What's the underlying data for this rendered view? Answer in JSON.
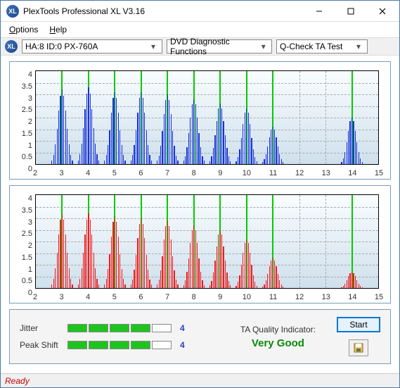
{
  "titlebar": {
    "title": "PlexTools Professional XL V3.16"
  },
  "menu": {
    "options": "Options",
    "help": "Help"
  },
  "toolbar": {
    "drive": "HA:8 ID:0   PX-760A",
    "func": "DVD Diagnostic Functions",
    "test": "Q-Check TA Test"
  },
  "chart_data": [
    {
      "type": "bar",
      "color": "#1330d8",
      "ylim": [
        0,
        4
      ],
      "xlim": [
        2,
        15
      ],
      "yticks": [
        0,
        0.5,
        1,
        1.5,
        2,
        2.5,
        3,
        3.5,
        4
      ],
      "xticks": [
        2,
        3,
        4,
        5,
        6,
        7,
        8,
        9,
        10,
        11,
        12,
        13,
        14,
        15
      ],
      "centers": [
        3,
        4,
        5,
        6,
        7,
        8,
        9,
        10,
        11,
        14
      ],
      "peaks": [
        3.2,
        3.3,
        3.1,
        3.1,
        3.0,
        2.8,
        2.6,
        2.4,
        1.6,
        2.0
      ]
    },
    {
      "type": "bar",
      "color": "#ef1a1a",
      "ylim": [
        0,
        4
      ],
      "xlim": [
        2,
        15
      ],
      "yticks": [
        0,
        0.5,
        1,
        1.5,
        2,
        2.5,
        3,
        3.5,
        4
      ],
      "xticks": [
        2,
        3,
        4,
        5,
        6,
        7,
        8,
        9,
        10,
        11,
        12,
        13,
        14,
        15
      ],
      "centers": [
        3,
        4,
        5,
        6,
        7,
        8,
        9,
        10,
        11,
        14
      ],
      "peaks": [
        3.2,
        3.2,
        3.1,
        3.0,
        2.9,
        2.7,
        2.5,
        2.1,
        1.3,
        0.7
      ]
    }
  ],
  "metrics": {
    "jitter": {
      "label": "Jitter",
      "value": "4",
      "bars_on": 4,
      "bars_total": 5
    },
    "peak": {
      "label": "Peak Shift",
      "value": "4",
      "bars_on": 4,
      "bars_total": 5
    }
  },
  "ta": {
    "label": "TA Quality Indicator:",
    "value": "Very Good"
  },
  "buttons": {
    "start": "Start"
  },
  "status": {
    "text": "Ready"
  }
}
